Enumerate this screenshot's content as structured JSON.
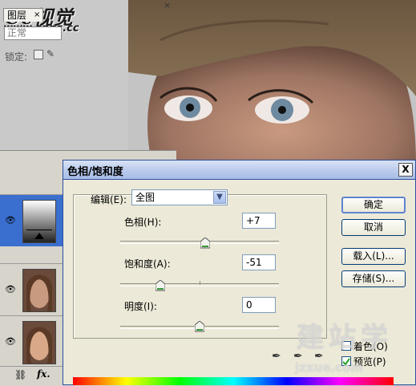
{
  "watermark": {
    "logo": "Cc视觉",
    "url": "www.spps.cc",
    "site_cn": "建站学",
    "site_url": "jzxue.com"
  },
  "layers_panel": {
    "tab_label": "图层",
    "close_glyph": "×",
    "blend_mode": "正常",
    "lock_label": "锁定:",
    "footer_fx": "fx."
  },
  "dialog": {
    "title": "色相/饱和度",
    "close_glyph": "X",
    "edit_label": "编辑(E):",
    "edit_value": "全图",
    "hue_label": "色相(H):",
    "hue_value": "+7",
    "saturation_label": "饱和度(A):",
    "saturation_value": "-51",
    "lightness_label": "明度(I):",
    "lightness_value": "0",
    "buttons": {
      "ok": "确定",
      "cancel": "取消",
      "load": "载入(L)...",
      "save": "存储(S)..."
    },
    "colorize_label": "着色(O)",
    "colorize_checked": false,
    "preview_label": "预览(P)",
    "preview_checked": true
  }
}
